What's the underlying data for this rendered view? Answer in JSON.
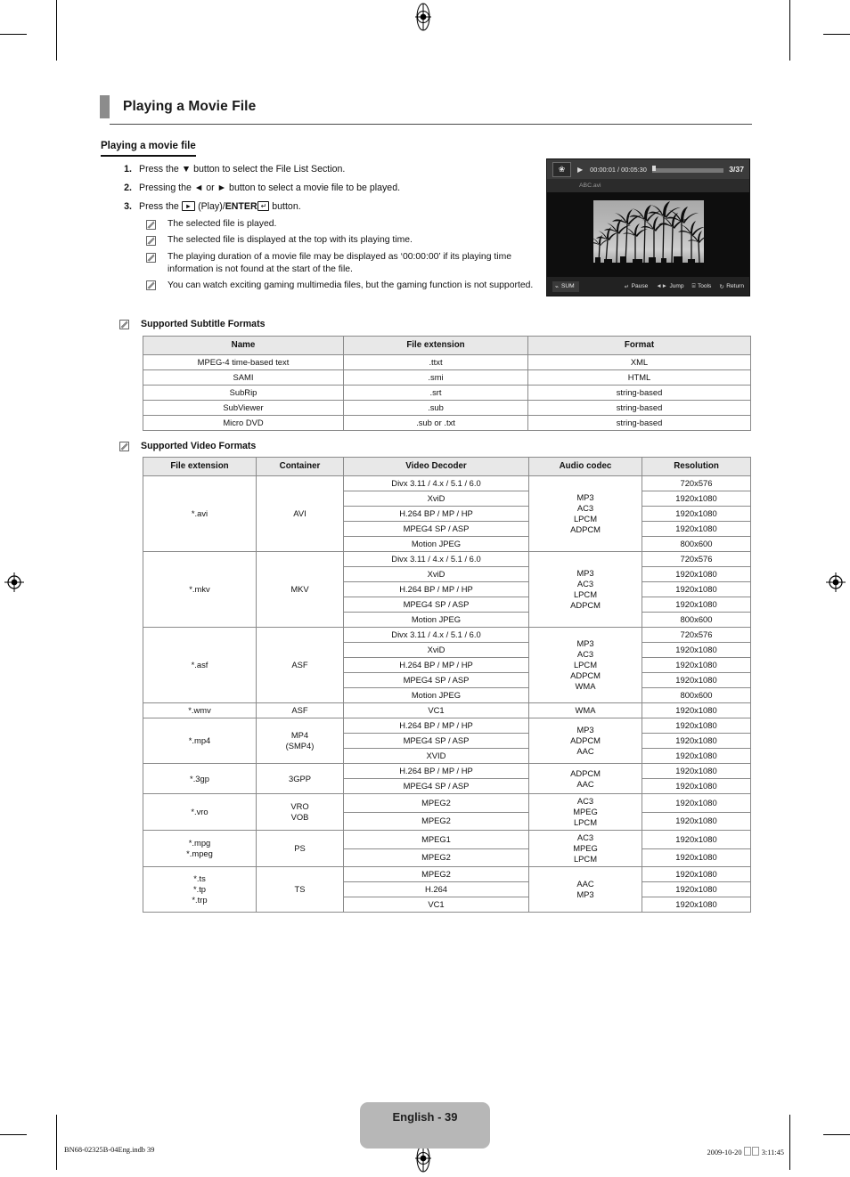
{
  "document": {
    "chapter_title": "Playing a Movie File",
    "section_title": "Playing a movie file",
    "page_label": "English - 39",
    "footer_left": "BN68-02325B-04Eng.indb   39",
    "footer_right_date": "2009-10-20",
    "footer_right_time": "3:11:45"
  },
  "steps": [
    {
      "num": "1.",
      "text_before": "Press the ▼ button to select the File List Section.",
      "text_after": ""
    },
    {
      "num": "2.",
      "text_before": "Pressing the ◄ or ► button to select a movie file to be played.",
      "text_after": ""
    },
    {
      "num": "3.",
      "text_before": "Press the ",
      "play_key": "►",
      "mid": " (Play)/",
      "enter_bold": "ENTER",
      "enter_key": "↵",
      "text_after": " button."
    }
  ],
  "notes": [
    "The selected file is played.",
    "The selected file is displayed at the top with its playing time.",
    "The playing duration of a movie file may be displayed as ‘00:00:00’ if its playing time information is not found at the start of the file.",
    "You can watch exciting gaming multimedia files, but the gaming function is not supported."
  ],
  "note_headings": {
    "subtitle_formats": "Supported Subtitle Formats",
    "video_formats": "Supported Video Formats"
  },
  "subtitle_table": {
    "headers": [
      "Name",
      "File extension",
      "Format"
    ],
    "rows": [
      [
        "MPEG-4 time-based text",
        ".ttxt",
        "XML"
      ],
      [
        "SAMI",
        ".smi",
        "HTML"
      ],
      [
        "SubRip",
        ".srt",
        "string-based"
      ],
      [
        "SubViewer",
        ".sub",
        "string-based"
      ],
      [
        "Micro DVD",
        ".sub or .txt",
        "string-based"
      ]
    ]
  },
  "video_table": {
    "headers": [
      "File extension",
      "Container",
      "Video Decoder",
      "Audio codec",
      "Resolution"
    ],
    "groups": [
      {
        "file_extension": "*.avi",
        "container": "AVI",
        "audio_codec": "MP3\nAC3\nLPCM\nADPCM",
        "decoders": [
          {
            "decoder": "Divx 3.11 / 4.x / 5.1 / 6.0",
            "resolution": "720x576"
          },
          {
            "decoder": "XviD",
            "resolution": "1920x1080"
          },
          {
            "decoder": "H.264 BP / MP / HP",
            "resolution": "1920x1080"
          },
          {
            "decoder": "MPEG4 SP / ASP",
            "resolution": "1920x1080"
          },
          {
            "decoder": "Motion JPEG",
            "resolution": "800x600"
          }
        ]
      },
      {
        "file_extension": "*.mkv",
        "container": "MKV",
        "audio_codec": "MP3\nAC3\nLPCM\nADPCM",
        "decoders": [
          {
            "decoder": "Divx 3.11 / 4.x / 5.1 / 6.0",
            "resolution": "720x576"
          },
          {
            "decoder": "XviD",
            "resolution": "1920x1080"
          },
          {
            "decoder": "H.264 BP / MP / HP",
            "resolution": "1920x1080"
          },
          {
            "decoder": "MPEG4 SP / ASP",
            "resolution": "1920x1080"
          },
          {
            "decoder": "Motion JPEG",
            "resolution": "800x600"
          }
        ]
      },
      {
        "file_extension": "*.asf",
        "container": "ASF",
        "audio_codec": "MP3\nAC3\nLPCM\nADPCM\nWMA",
        "decoders": [
          {
            "decoder": "Divx 3.11 / 4.x / 5.1 / 6.0",
            "resolution": "720x576"
          },
          {
            "decoder": "XviD",
            "resolution": "1920x1080"
          },
          {
            "decoder": "H.264 BP / MP / HP",
            "resolution": "1920x1080"
          },
          {
            "decoder": "MPEG4 SP / ASP",
            "resolution": "1920x1080"
          },
          {
            "decoder": "Motion JPEG",
            "resolution": "800x600"
          }
        ]
      },
      {
        "file_extension": "*.wmv",
        "container": "ASF",
        "audio_codec": "WMA",
        "decoders": [
          {
            "decoder": "VC1",
            "resolution": "1920x1080"
          }
        ]
      },
      {
        "file_extension": "*.mp4",
        "container": "MP4\n(SMP4)",
        "audio_codec": "MP3\nADPCM\nAAC",
        "decoders": [
          {
            "decoder": "H.264 BP / MP / HP",
            "resolution": "1920x1080"
          },
          {
            "decoder": "MPEG4 SP / ASP",
            "resolution": "1920x1080"
          },
          {
            "decoder": "XVID",
            "resolution": "1920x1080"
          }
        ]
      },
      {
        "file_extension": "*.3gp",
        "container": "3GPP",
        "audio_codec": "ADPCM\nAAC",
        "decoders": [
          {
            "decoder": "H.264 BP / MP / HP",
            "resolution": "1920x1080"
          },
          {
            "decoder": "MPEG4 SP / ASP",
            "resolution": "1920x1080"
          }
        ]
      },
      {
        "file_extension": "*.vro",
        "container": "VRO\nVOB",
        "audio_codec": "AC3\nMPEG\nLPCM",
        "decoders": [
          {
            "decoder": "MPEG2",
            "resolution": "1920x1080"
          },
          {
            "decoder": "MPEG2",
            "resolution": "1920x1080"
          }
        ]
      },
      {
        "file_extension": "*.mpg\n*.mpeg",
        "container": "PS",
        "audio_codec": "AC3\nMPEG\nLPCM",
        "decoders": [
          {
            "decoder": "MPEG1",
            "resolution": "1920x1080"
          },
          {
            "decoder": "MPEG2",
            "resolution": "1920x1080"
          }
        ]
      },
      {
        "file_extension": "*.ts\n*.tp\n*.trp",
        "container": "TS",
        "audio_codec": "AAC\nMP3",
        "decoders": [
          {
            "decoder": "MPEG2",
            "resolution": "1920x1080"
          },
          {
            "decoder": "H.264",
            "resolution": "1920x1080"
          },
          {
            "decoder": "VC1",
            "resolution": "1920x1080"
          }
        ]
      }
    ]
  },
  "tv_screenshot": {
    "elapsed_total": "00:00:01 / 00:05:30",
    "file_counter": "3/37",
    "file_name": "ABC.avi",
    "sum_label": "SUM",
    "actions": [
      {
        "glyph": "↵",
        "label": "Pause"
      },
      {
        "glyph": "◄►",
        "label": "Jump"
      },
      {
        "glyph": "⌸",
        "label": "Tools"
      },
      {
        "glyph": "↻",
        "label": "Return"
      }
    ]
  },
  "colors": {
    "accent_gray": "#8c8c8c",
    "table_header": "#e8e8e8",
    "page_badge": "#b7b7b7"
  }
}
